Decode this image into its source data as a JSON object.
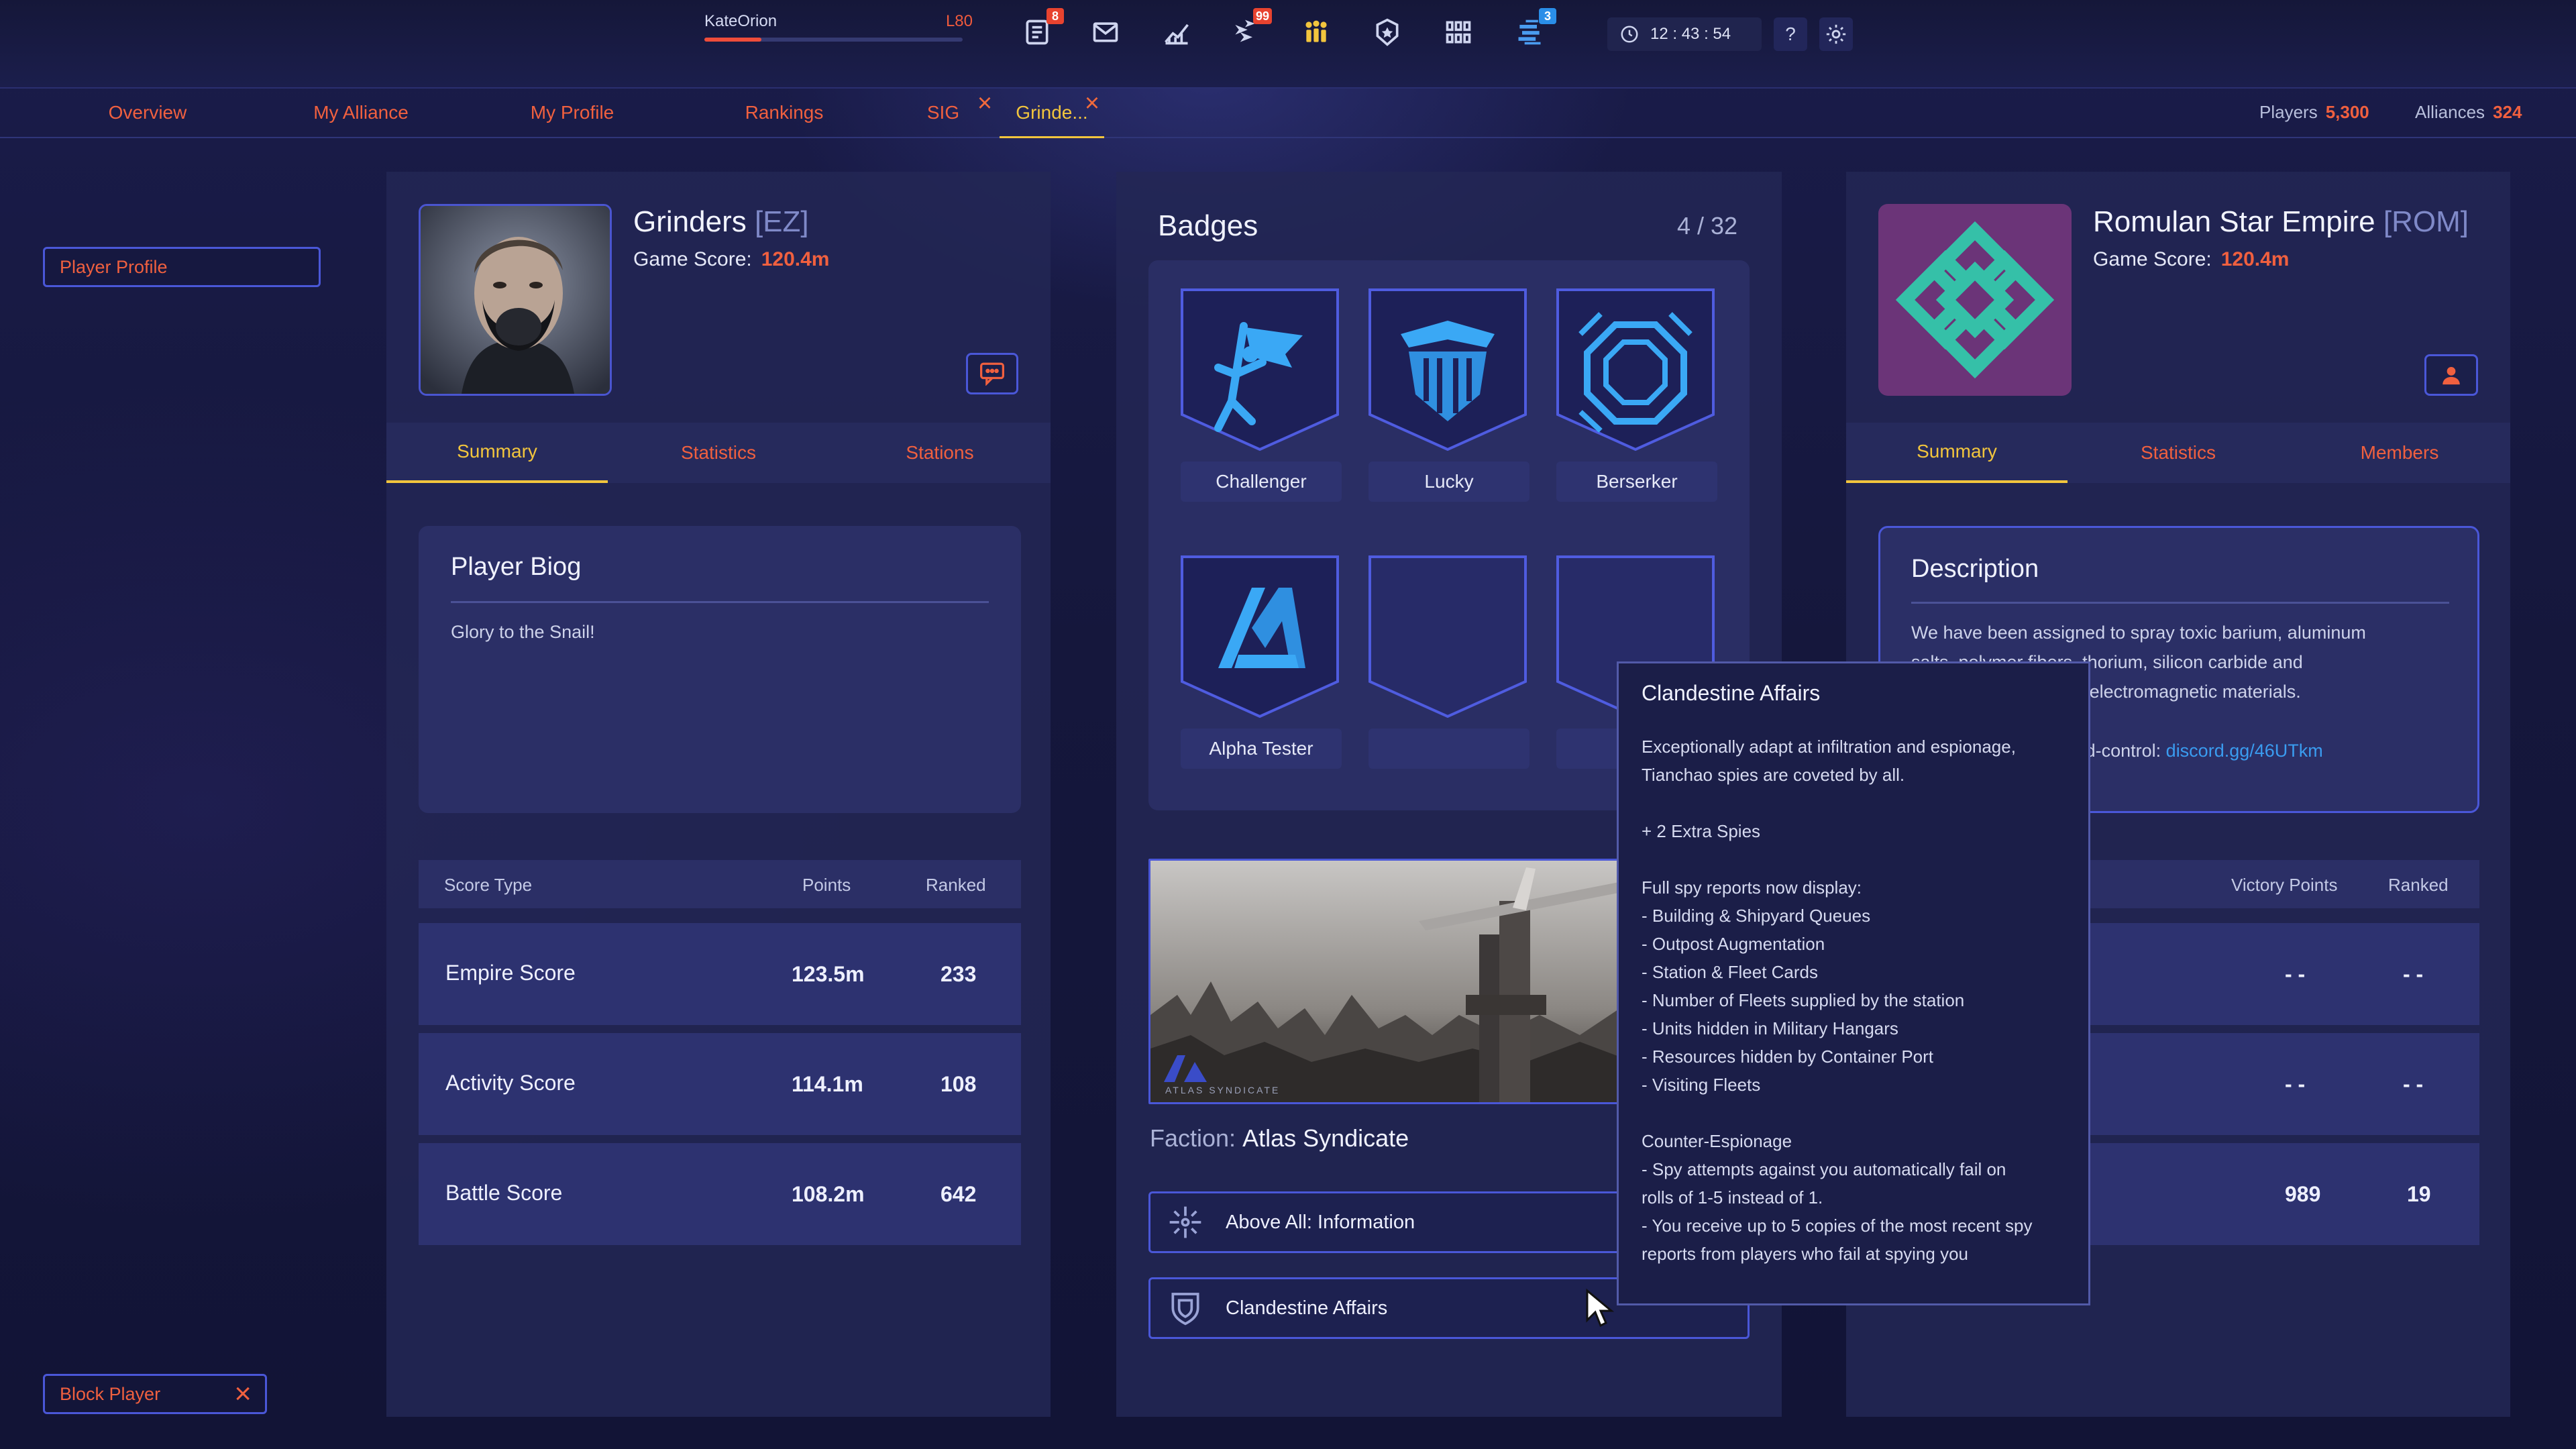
{
  "topbar": {
    "player_name": "KateOrion",
    "player_level": "L80",
    "xp_progress": 0.22,
    "icons": [
      {
        "name": "news-icon",
        "badge": "8",
        "badge_color": "red"
      },
      {
        "name": "mail-icon",
        "badge": "",
        "badge_color": ""
      },
      {
        "name": "chart-icon",
        "badge": "",
        "badge_color": ""
      },
      {
        "name": "fleets-icon",
        "badge": "99",
        "badge_color": "red"
      },
      {
        "name": "alliance-icon",
        "badge": "",
        "badge_color": ""
      },
      {
        "name": "rank-star-icon",
        "badge": "",
        "badge_color": ""
      },
      {
        "name": "grid-icon",
        "badge": "",
        "badge_color": ""
      },
      {
        "name": "empire-icon",
        "badge": "3",
        "badge_color": "blue"
      }
    ],
    "clock": "12 : 43 : 54",
    "help_label": "?"
  },
  "nav": {
    "tabs": [
      "Overview",
      "My Alliance",
      "My Profile",
      "Rankings",
      "SIG",
      "Grinde..."
    ],
    "active_tab": "Grinde...",
    "players_label": "Players",
    "players_value": "5,300",
    "alliances_label": "Alliances",
    "alliances_value": "324"
  },
  "sidebar": {
    "player_profile_label": "Player Profile",
    "block_player_label": "Block Player"
  },
  "player": {
    "name": "Grinders",
    "tag": "[EZ]",
    "game_score_label": "Game Score:",
    "game_score": "120.4m",
    "subtabs": [
      "Summary",
      "Statistics",
      "Stations"
    ],
    "biog_title": "Player Biog",
    "biog_text": "Glory to the Snail!",
    "score_headers": [
      "Score Type",
      "Points",
      "Ranked"
    ],
    "scores": [
      {
        "type": "Empire Score",
        "points": "123.5m",
        "ranked": "233"
      },
      {
        "type": "Activity Score",
        "points": "114.1m",
        "ranked": "108"
      },
      {
        "type": "Battle Score",
        "points": "108.2m",
        "ranked": "642"
      }
    ]
  },
  "badges": {
    "title": "Badges",
    "count": "4 / 32",
    "items": [
      "Challenger",
      "Lucky",
      "Berserker",
      "Alpha Tester",
      "",
      ""
    ]
  },
  "faction": {
    "label": "Faction:",
    "name": "Atlas Syndicate",
    "image_caption": "ATLAS SYNDICATE",
    "perks": [
      "Above All: Information",
      "Clandestine Affairs"
    ]
  },
  "alliance": {
    "name": "Romulan Star Empire",
    "tag": "[ROM]",
    "game_score_label": "Game Score:",
    "game_score": "120.4m",
    "subtabs": [
      "Summary",
      "Statistics",
      "Members"
    ],
    "desc_title": "Description",
    "desc_line1": "We have been assigned to spray toxic barium, aluminum",
    "desc_line2": "salts, polymer fibers, thorium, silicon carbide and",
    "desc_line3": "other toxic or reactive electromagnetic materials.",
    "desc_line4": "Join our ranks for mind-control:",
    "desc_link": "discord.gg/46UTkm",
    "vp_headers": [
      "Victory Points",
      "Ranked"
    ],
    "rows": [
      {
        "vp": "- -",
        "ranked": "- -"
      },
      {
        "vp": "- -",
        "ranked": "- -"
      },
      {
        "vp": "989",
        "ranked": "19"
      }
    ]
  },
  "tooltip": {
    "title": "Clandestine Affairs",
    "body": "Exceptionally adapt at infiltration and espionage,\nTianchao spies are coveted by all.\n\n+ 2 Extra Spies\n\nFull spy reports now display:\n- Building & Shipyard Queues\n- Outpost Augmentation\n- Station & Fleet Cards\n- Number of Fleets supplied by the station\n- Units hidden in Military Hangars\n- Resources hidden by Container Port\n- Visiting Fleets\n\nCounter-Espionage\n- Spy attempts against you automatically fail on\n  rolls of 1-5 instead of 1.\n- You receive up to 5 copies of the most recent spy\n  reports from players who fail at spying you"
  }
}
